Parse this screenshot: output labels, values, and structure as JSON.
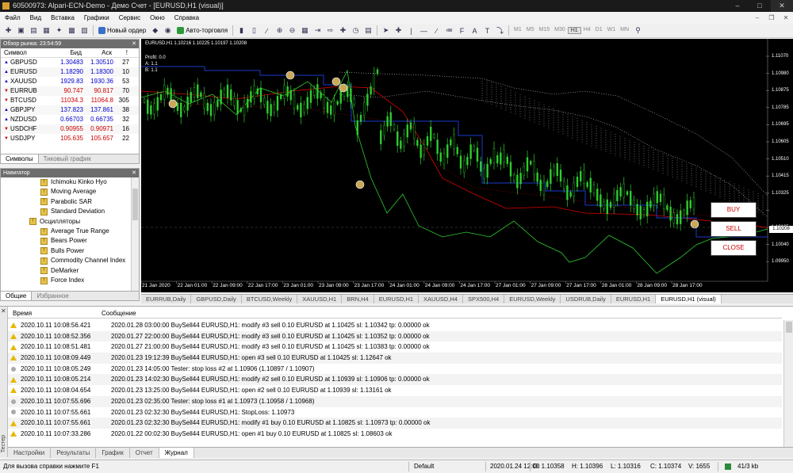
{
  "window": {
    "title": "60500973: Alpari-ECN-Demo - Демо Счет - [EURUSD,H1 (visual)]"
  },
  "menu": [
    "Файл",
    "Вид",
    "Вставка",
    "Графики",
    "Сервис",
    "Окно",
    "Справка"
  ],
  "toolbar": {
    "new_order": "Новый ордер",
    "autotrading": "Авто-торговля",
    "timeframes": [
      "M1",
      "M5",
      "M15",
      "M30",
      "H1",
      "H4",
      "D1",
      "W1",
      "MN"
    ],
    "active_timeframe": "H1"
  },
  "market_watch": {
    "header": "Обзор рынка: 23:54:59",
    "columns": [
      "Символ",
      "Бид",
      "Аск",
      "!"
    ],
    "rows": [
      {
        "symbol": "GBPUSD",
        "bid": "1.30483",
        "ask": "1.30510",
        "spread": "27",
        "color": "#0000cc",
        "dir": "up"
      },
      {
        "symbol": "EURUSD",
        "bid": "1.18290",
        "ask": "1.18300",
        "spread": "10",
        "color": "#0000cc",
        "dir": "up"
      },
      {
        "symbol": "XAUUSD",
        "bid": "1929.83",
        "ask": "1930.36",
        "spread": "53",
        "color": "#0000cc",
        "dir": "up"
      },
      {
        "symbol": "EURRUB",
        "bid": "90.747",
        "ask": "90.817",
        "spread": "70",
        "color": "#cc0000",
        "dir": "down"
      },
      {
        "symbol": "BTCUSD",
        "bid": "11034.3",
        "ask": "11064.8",
        "spread": "305",
        "color": "#cc0000",
        "dir": "down"
      },
      {
        "symbol": "GBPJPY",
        "bid": "137.823",
        "ask": "137.861",
        "spread": "38",
        "color": "#0000cc",
        "dir": "up"
      },
      {
        "symbol": "NZDUSD",
        "bid": "0.66703",
        "ask": "0.66735",
        "spread": "32",
        "color": "#0000cc",
        "dir": "up"
      },
      {
        "symbol": "USDCHF",
        "bid": "0.90955",
        "ask": "0.90971",
        "spread": "16",
        "color": "#cc0000",
        "dir": "down"
      },
      {
        "symbol": "USDJPY",
        "bid": "105.635",
        "ask": "105.657",
        "spread": "22",
        "color": "#cc0000",
        "dir": "down"
      }
    ],
    "tabs": [
      "Символы",
      "Тиковый график"
    ]
  },
  "navigator": {
    "header": "Навигатор",
    "items": [
      {
        "label": "Ichimoku Kinko Hyo",
        "indent": 50
      },
      {
        "label": "Moving Average",
        "indent": 50
      },
      {
        "label": "Parabolic SAR",
        "indent": 50
      },
      {
        "label": "Standard Deviation",
        "indent": 50
      },
      {
        "label": "Осцилляторы",
        "indent": 36
      },
      {
        "label": "Average True Range",
        "indent": 50
      },
      {
        "label": "Bears Power",
        "indent": 50
      },
      {
        "label": "Bulls Power",
        "indent": 50
      },
      {
        "label": "Commodity Channel Index",
        "indent": 50
      },
      {
        "label": "DeMarker",
        "indent": 50
      },
      {
        "label": "Force Index",
        "indent": 50
      }
    ],
    "tabs": [
      "Общие",
      "Избранное"
    ]
  },
  "chart": {
    "symbol_line": "EURUSD,H1  1.10216  1.10225  1.10197  1.10208",
    "info": [
      "Profit: 0.0",
      "A: 1.1",
      "B: 1.1"
    ],
    "price_labels": [
      "1.11070",
      "1.10980",
      "1.10875",
      "1.10785",
      "1.10695",
      "1.10605",
      "1.10510",
      "1.10415",
      "1.10325",
      "1.10208",
      "1.10135",
      "1.10040",
      "1.09950"
    ],
    "current_price": "1.10208",
    "time_labels": [
      "21 Jan 2020",
      "22 Jan 01:00",
      "22 Jan 09:00",
      "22 Jan 17:00",
      "23 Jan 01:00",
      "23 Jan 09:00",
      "23 Jan 17:00",
      "24 Jan 01:00",
      "24 Jan 09:00",
      "24 Jan 17:00",
      "27 Jan 01:00",
      "27 Jan 09:00",
      "27 Jan 17:00",
      "28 Jan 01:00",
      "28 Jan 09:00",
      "28 Jan 17:00"
    ],
    "buttons": {
      "buy": "BUY",
      "sell": "SELL",
      "close": "CLOSE"
    }
  },
  "chart_tabs": [
    "EURRUB,Daily",
    "GBPUSD,Daily",
    "BTCUSD,Weekly",
    "XAUUSD,H1",
    "BRN,H4",
    "EURUSD,H1",
    "XAUUSD,H4",
    "SPX500,H4",
    "EURUSD,Weekly",
    "USDRUB,Daily",
    "EURUSD,H1",
    "EURUSD,H1 (visual)"
  ],
  "journal": {
    "side_label": "Тестер",
    "columns": [
      "Время",
      "Сообщение"
    ],
    "rows": [
      {
        "icon": "warn",
        "time": "2020.10.11 10:08:56.421",
        "msg": "2020.01.28 03:00:00  BuySell44 EURUSD,H1: modify #3 sell 0.10 EURUSD at 1.10425 sl: 1.10342 tp: 0.00000 ok"
      },
      {
        "icon": "warn",
        "time": "2020.10.11 10:08:52.356",
        "msg": "2020.01.27 22:00:00  BuySell44 EURUSD,H1: modify #3 sell 0.10 EURUSD at 1.10425 sl: 1.10352 tp: 0.00000 ok"
      },
      {
        "icon": "warn",
        "time": "2020.10.11 10:08:51.481",
        "msg": "2020.01.27 21:00:00  BuySell44 EURUSD,H1: modify #3 sell 0.10 EURUSD at 1.10425 sl: 1.10383 tp: 0.00000 ok"
      },
      {
        "icon": "warn",
        "time": "2020.10.11 10:08:09.449",
        "msg": "2020.01.23 19:12:39  BuySell44 EURUSD,H1: open #3 sell 0.10 EURUSD at 1.10425 sl: 1.12647 ok"
      },
      {
        "icon": "info",
        "time": "2020.10.11 10:08:05.249",
        "msg": "2020.01.23 14:05:00  Tester: stop loss #2 at 1.10906 (1.10897 / 1.10907)"
      },
      {
        "icon": "warn",
        "time": "2020.10.11 10:08:05.214",
        "msg": "2020.01.23 14:02:30  BuySell44 EURUSD,H1: modify #2 sell 0.10 EURUSD at 1.10939 sl: 1.10906 tp: 0.00000 ok"
      },
      {
        "icon": "warn",
        "time": "2020.10.11 10:08:04.654",
        "msg": "2020.01.23 13:25:00  BuySell44 EURUSD,H1: open #2 sell 0.10 EURUSD at 1.10939 sl: 1.13161 ok"
      },
      {
        "icon": "info",
        "time": "2020.10.11 10:07:55.696",
        "msg": "2020.01.23 02:35:00  Tester: stop loss #1 at 1.10973 (1.10958 / 1.10968)"
      },
      {
        "icon": "info",
        "time": "2020.10.11 10:07:55.661",
        "msg": "2020.01.23 02:32:30  BuySell44 EURUSD,H1: StopLoss: 1.10973"
      },
      {
        "icon": "warn",
        "time": "2020.10.11 10:07:55.661",
        "msg": "2020.01.23 02:32:30  BuySell44 EURUSD,H1: modify #1 buy 0.10 EURUSD at 1.10825 sl: 1.10973 tp: 0.00000 ok"
      },
      {
        "icon": "warn",
        "time": "2020.10.11 10:07:33.286",
        "msg": "2020.01.22 00:02:30  BuySell44 EURUSD,H1: open #1 buy 0.10 EURUSD at 1.10825 sl: 1.08603 ok"
      }
    ],
    "tabs": [
      "Настройки",
      "Результаты",
      "График",
      "Отчет",
      "Журнал"
    ],
    "active_tab": "Журнал"
  },
  "status": {
    "help": "Для вызова справки нажмите F1",
    "profile": "Default",
    "time": "2020.01.24 12:00",
    "open": "O: 1.10358",
    "high": "H: 1.10396",
    "low": "L: 1.10316",
    "close": "C: 1.10374",
    "volume": "V: 1655",
    "traffic": "41/3 kb"
  }
}
